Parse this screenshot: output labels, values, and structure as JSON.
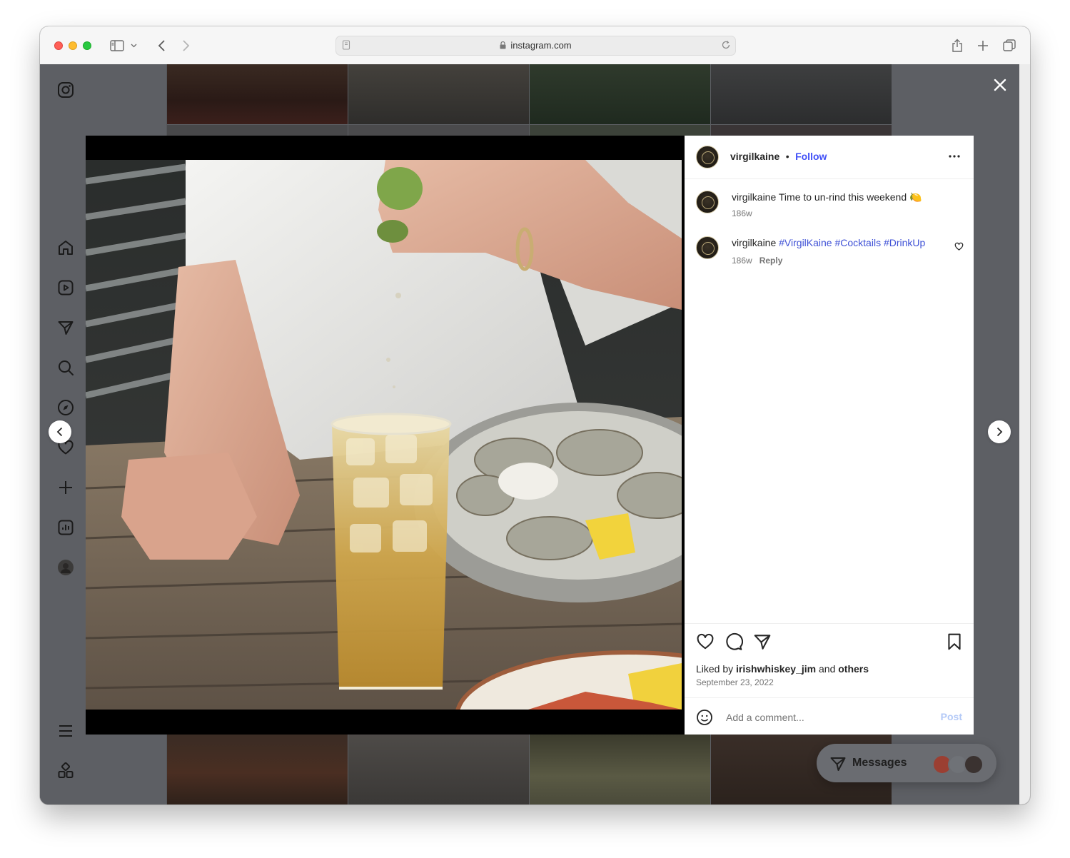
{
  "browser": {
    "url": "instagram.com"
  },
  "post": {
    "username": "virgilkaine",
    "follow_label": "Follow",
    "separator": "•",
    "caption_user": "virgilkaine",
    "caption_text": "Time to un-rind this weekend 🍋",
    "caption_age": "186w",
    "comment_user": "virgilkaine",
    "comment_tags": "#VirgilKaine #Cocktails #DrinkUp",
    "comment_age": "186w",
    "reply_label": "Reply",
    "liked_prefix": "Liked by",
    "liked_user": "irishwhiskey_jim",
    "liked_and": "and",
    "liked_others": "others",
    "date": "September 23, 2022",
    "comment_placeholder": "Add a comment...",
    "post_label": "Post"
  },
  "messages": {
    "label": "Messages"
  },
  "colors": {
    "follow": "#4150f7",
    "hashtag": "#3f51d6",
    "post_disabled": "#b3c9f7"
  },
  "icons": [
    "instagram-icon",
    "home-icon",
    "reels-icon",
    "direct-icon",
    "search-icon",
    "explore-icon",
    "heart-icon",
    "create-icon",
    "insights-icon",
    "profile-avatar",
    "menu-icon",
    "threads-icon",
    "close-icon",
    "chevron-left-icon",
    "chevron-right-icon",
    "more-icon",
    "comment-icon",
    "share-icon",
    "bookmark-icon",
    "emoji-icon"
  ]
}
